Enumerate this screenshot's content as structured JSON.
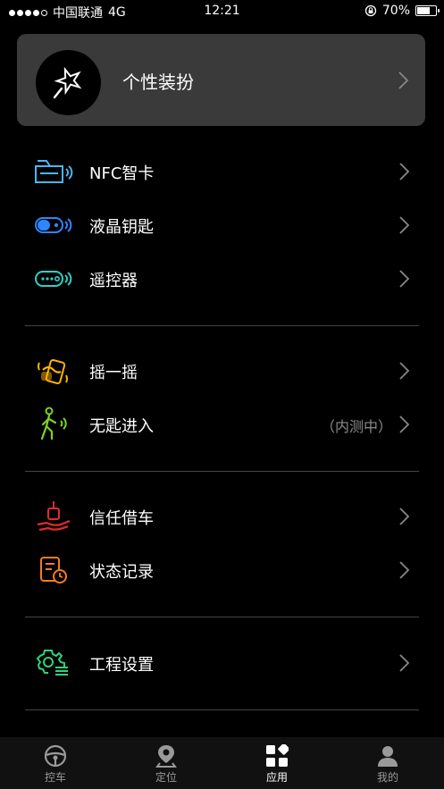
{
  "status_bar": {
    "carrier": "中国联通",
    "network": "4G",
    "time": "12:21",
    "battery": "70%",
    "battery_level": 0.7
  },
  "personalize": {
    "label": "个性装扮",
    "icon": "magic-wand-icon"
  },
  "groups": [
    {
      "items": [
        {
          "label": "NFC智卡",
          "icon": "nfc-card-icon",
          "color": "#4bb6f0"
        },
        {
          "label": "液晶钥匙",
          "icon": "lcd-key-icon",
          "color": "#2e86ff"
        },
        {
          "label": "遥控器",
          "icon": "remote-control-icon",
          "color": "#2ed0c8"
        }
      ]
    },
    {
      "items": [
        {
          "label": "摇一摇",
          "icon": "shake-hand-icon",
          "color": "#ffb400"
        },
        {
          "label": "无匙进入",
          "icon": "keyless-walk-icon",
          "color": "#7ed321",
          "note": "（内测中）"
        }
      ]
    },
    {
      "items": [
        {
          "label": "信任借车",
          "icon": "trust-lend-car-icon",
          "color": "#e32b2b"
        },
        {
          "label": "状态记录",
          "icon": "status-record-icon",
          "color": "#f57c1f"
        }
      ]
    },
    {
      "items": [
        {
          "label": "工程设置",
          "icon": "engineering-settings-icon",
          "color": "#2fd37a"
        }
      ]
    }
  ],
  "tabs": [
    {
      "label": "控车",
      "icon": "steering-wheel-icon",
      "active": false
    },
    {
      "label": "定位",
      "icon": "location-pin-icon",
      "active": false
    },
    {
      "label": "应用",
      "icon": "apps-grid-icon",
      "active": true
    },
    {
      "label": "我的",
      "icon": "user-profile-icon",
      "active": false
    }
  ]
}
